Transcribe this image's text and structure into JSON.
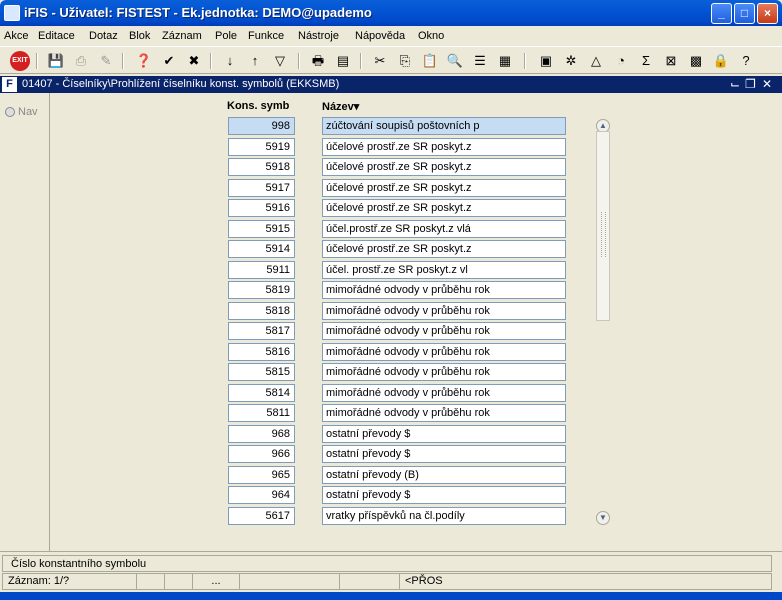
{
  "window": {
    "title": "iFIS - Uživatel: FISTEST - Ek.jednotka: DEMO@upademo",
    "minimize": "_",
    "maximize": "□",
    "close": "×"
  },
  "menu": [
    "Akce",
    "Editace",
    "Dotaz",
    "Blok",
    "Záznam",
    "Pole",
    "Funkce",
    "Nástroje",
    "Nápověda",
    "Okno"
  ],
  "toolbar": {
    "exit_label": "EXIT",
    "icons": [
      "save-icon",
      "print-icon",
      "clear-icon",
      "query-enter-icon",
      "query-execute-icon",
      "query-cancel-icon",
      "sort-asc-icon",
      "sort-desc-icon",
      "filter-icon",
      "print-form-icon",
      "export-icon",
      "cut-icon",
      "copy-icon",
      "paste-icon",
      "find-icon",
      "list-icon",
      "grid-icon",
      "calculator-icon",
      "settings-icon",
      "tree-icon",
      "chart-icon",
      "sum-icon",
      "excel-icon",
      "map-icon",
      "lock-icon",
      "user-help-icon",
      "help-icon"
    ]
  },
  "form": {
    "title": "01407 - Číselníky\\Prohlížení číselníku konst. symbolů (EKKSMB)",
    "icon_label": "F"
  },
  "nav": {
    "label": "Nav"
  },
  "columns": {
    "code": "Kons. symb",
    "name": "Název▾"
  },
  "rows": [
    {
      "code": "998",
      "name": "zúčtování soupisů poštovních p",
      "selected": true
    },
    {
      "code": "5919",
      "name": "účelové prostř.ze SR poskyt.z"
    },
    {
      "code": "5918",
      "name": "účelové prostř.ze SR poskyt.z"
    },
    {
      "code": "5917",
      "name": "účelové prostř.ze SR poskyt.z"
    },
    {
      "code": "5916",
      "name": "účelové prostř.ze SR poskyt.z"
    },
    {
      "code": "5915",
      "name": "účel.prostř.ze SR poskyt.z vlá"
    },
    {
      "code": "5914",
      "name": "účelové prostř.ze SR poskyt.z"
    },
    {
      "code": "5911",
      "name": "účel. prostř.ze SR poskyt.z vl"
    },
    {
      "code": "5819",
      "name": "mimořádné odvody v průběhu rok"
    },
    {
      "code": "5818",
      "name": "mimořádné odvody v průběhu rok"
    },
    {
      "code": "5817",
      "name": "mimořádné odvody v průběhu rok"
    },
    {
      "code": "5816",
      "name": "mimořádné odvody v průběhu rok"
    },
    {
      "code": "5815",
      "name": "mimořádné odvody v průběhu rok"
    },
    {
      "code": "5814",
      "name": "mimořádné odvody v průběhu rok"
    },
    {
      "code": "5811",
      "name": "mimořádné odvody v průběhu rok"
    },
    {
      "code": "968",
      "name": "ostatní převody $"
    },
    {
      "code": "966",
      "name": "ostatní převody $"
    },
    {
      "code": "965",
      "name": "ostatní převody (B)"
    },
    {
      "code": "964",
      "name": "ostatní převody $"
    },
    {
      "code": "5617",
      "name": "vratky příspěvků na čl.podíly"
    }
  ],
  "hint": "Číslo konstantního symbolu",
  "status": {
    "record": "Záznam: 1/?",
    "ellipsis": "...",
    "mode": "<PŘOS"
  }
}
